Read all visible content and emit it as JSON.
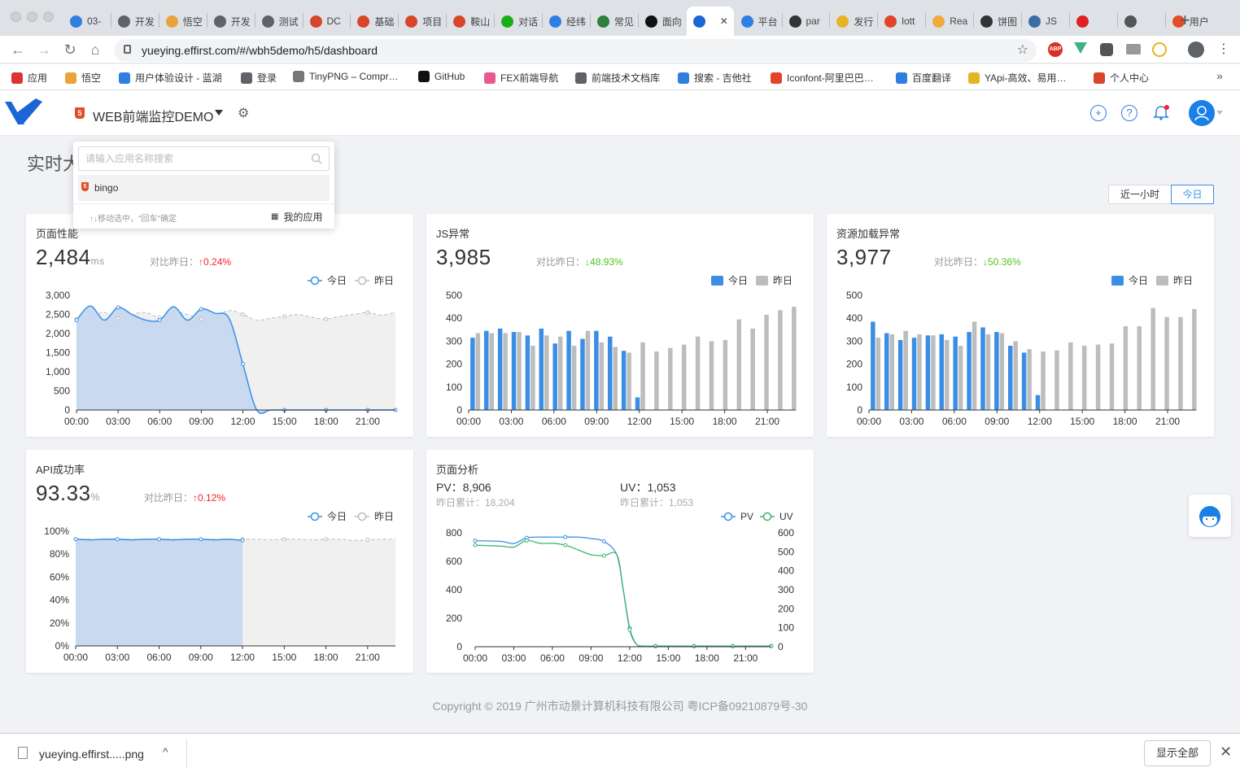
{
  "browser": {
    "tabs": [
      {
        "label": "03-",
        "color": "#2f7fe0"
      },
      {
        "label": "开发",
        "color": "#5f6368"
      },
      {
        "label": "悟空",
        "color": "#e8a33c"
      },
      {
        "label": "开发",
        "color": "#5f6368"
      },
      {
        "label": "测试",
        "color": "#5f6368"
      },
      {
        "label": "DC",
        "color": "#d9452b"
      },
      {
        "label": "基础",
        "color": "#d9452b"
      },
      {
        "label": "项目",
        "color": "#d9452b"
      },
      {
        "label": "鞍山",
        "color": "#d9452b"
      },
      {
        "label": "对话",
        "color": "#1aad19"
      },
      {
        "label": "经纬",
        "color": "#2f7fe0"
      },
      {
        "label": "常见",
        "color": "#2f7f3e"
      },
      {
        "label": "面向",
        "color": "#111111"
      },
      {
        "label": "",
        "color": "#1a66d6"
      },
      {
        "label": "平台",
        "color": "#2f7fe0"
      },
      {
        "label": "par",
        "color": "#333333"
      },
      {
        "label": "发行",
        "color": "#e6b422"
      },
      {
        "label": "lott",
        "color": "#e24329"
      },
      {
        "label": "Rea",
        "color": "#f0a93b"
      },
      {
        "label": "饼图",
        "color": "#333333"
      },
      {
        "label": "JS",
        "color": "#3c6ea5"
      },
      {
        "label": "",
        "color": "#e02020"
      },
      {
        "label": "",
        "color": "#555555"
      },
      {
        "label": "用户",
        "color": "#e44d26"
      }
    ],
    "url": "yueying.effirst.com/#/wbh5demo/h5/dashboard",
    "bookmarks": [
      {
        "label": "应用",
        "color": "#d33"
      },
      {
        "label": "悟空",
        "color": "#e8a33c"
      },
      {
        "label": "用户体验设计 - 蓝湖",
        "color": "#2f7fe0"
      },
      {
        "label": "登录",
        "color": "#5f6368"
      },
      {
        "label": "TinyPNG – Compr…",
        "color": "#777"
      },
      {
        "label": "GitHub",
        "color": "#111"
      },
      {
        "label": "FEX前端导航",
        "color": "#e8588f"
      },
      {
        "label": "前端技术文档库",
        "color": "#5f6368"
      },
      {
        "label": "搜索 - 吉他社",
        "color": "#2f7fe0"
      },
      {
        "label": "Iconfont-阿里巴巴…",
        "color": "#e24329"
      },
      {
        "label": "百度翻译",
        "color": "#2f7fe0"
      },
      {
        "label": "YApi-高效、易用…",
        "color": "#e6b422"
      },
      {
        "label": "个人中心",
        "color": "#d9452b"
      }
    ],
    "more_label": "»"
  },
  "app": {
    "name": "WEB前端监控DEMO",
    "page_title": "实时大",
    "ranges": [
      "近一小时",
      "今日"
    ],
    "dropdown": {
      "placeholder": "请输入应用名称搜索",
      "item": "bingo",
      "hint": "↑↓移动选中，\"回车\"确定",
      "my_apps": "我的应用"
    },
    "footer": "Copyright © 2019 广州市动景计算机科技有限公司 粤ICP备09210879号-30",
    "download_file": "yueying.effirst.....png",
    "show_all": "显示全部"
  },
  "cards": {
    "perf": {
      "title": "页面性能",
      "value": "2,484",
      "unit": "ms",
      "compare_label": "对比昨日：",
      "compare_value": "0.24%",
      "legend_today": "今日",
      "legend_yesterday": "昨日"
    },
    "js": {
      "title": "JS异常",
      "value": "3,985",
      "compare_label": "对比昨日：",
      "compare_value": "48.93%",
      "legend_today": "今日",
      "legend_yesterday": "昨日"
    },
    "res": {
      "title": "资源加载异常",
      "value": "3,977",
      "compare_label": "对比昨日：",
      "compare_value": "50.36%",
      "legend_today": "今日",
      "legend_yesterday": "昨日"
    },
    "api": {
      "title": "API成功率",
      "value": "93.33",
      "unit": "%",
      "compare_label": "对比昨日：",
      "compare_value": "0.12%",
      "legend_today": "今日",
      "legend_yesterday": "昨日"
    },
    "page": {
      "title": "页面分析",
      "pv_label": "PV：",
      "pv_value": "8,906",
      "uv_label": "UV：",
      "uv_value": "1,053",
      "pv_prev": "昨日累计：18,204",
      "uv_prev": "昨日累计：1,053",
      "legend_pv": "PV",
      "legend_uv": "UV"
    }
  },
  "colors": {
    "today": "#3a8ee6",
    "yesterday": "#bdbdbd",
    "uv": "#3cb371",
    "up": "#f5222d",
    "down": "#52c41a"
  },
  "chart_data": [
    {
      "id": "perf",
      "type": "area",
      "x_ticks": [
        "00:00",
        "03:00",
        "06:00",
        "09:00",
        "12:00",
        "15:00",
        "18:00",
        "21:00"
      ],
      "y_ticks": [
        "0",
        "500",
        "1,000",
        "1,500",
        "2,000",
        "2,500",
        "3,000"
      ],
      "ylim": [
        0,
        3000
      ],
      "xlim": [
        0,
        23
      ],
      "series": [
        {
          "name": "今日",
          "x": [
            0,
            1,
            2,
            3,
            4,
            5,
            6,
            7,
            8,
            9,
            10,
            11,
            12,
            13,
            14,
            15,
            16,
            17,
            18,
            19,
            20,
            21,
            22,
            23
          ],
          "values": [
            2350,
            2720,
            2350,
            2680,
            2500,
            2350,
            2350,
            2700,
            2350,
            2640,
            2530,
            2400,
            1200,
            0,
            0,
            0,
            0,
            0,
            0,
            0,
            0,
            0,
            0,
            0
          ]
        },
        {
          "name": "昨日",
          "x": [
            0,
            1,
            2,
            3,
            4,
            5,
            6,
            7,
            8,
            9,
            10,
            11,
            12,
            13,
            14,
            15,
            16,
            17,
            18,
            19,
            20,
            21,
            22,
            23
          ],
          "values": [
            2380,
            2450,
            2550,
            2400,
            2500,
            2550,
            2420,
            2560,
            2500,
            2380,
            2450,
            2600,
            2500,
            2350,
            2400,
            2450,
            2500,
            2420,
            2380,
            2450,
            2500,
            2550,
            2480,
            2560
          ]
        }
      ]
    },
    {
      "id": "js",
      "type": "bar",
      "x_ticks": [
        "00:00",
        "03:00",
        "06:00",
        "09:00",
        "12:00",
        "15:00",
        "18:00",
        "21:00"
      ],
      "y_ticks": [
        "0",
        "100",
        "200",
        "300",
        "400",
        "500"
      ],
      "ylim": [
        0,
        500
      ],
      "series": [
        {
          "name": "今日",
          "values": [
            315,
            345,
            355,
            340,
            325,
            355,
            290,
            345,
            310,
            345,
            320,
            258,
            55,
            0,
            0,
            0,
            0,
            0,
            0,
            0,
            0,
            0,
            0,
            0
          ]
        },
        {
          "name": "昨日",
          "values": [
            335,
            335,
            335,
            340,
            280,
            325,
            320,
            280,
            345,
            295,
            275,
            250,
            295,
            255,
            270,
            285,
            320,
            300,
            305,
            395,
            355,
            415,
            435,
            450
          ]
        }
      ]
    },
    {
      "id": "res",
      "type": "bar",
      "x_ticks": [
        "00:00",
        "03:00",
        "06:00",
        "09:00",
        "12:00",
        "15:00",
        "18:00",
        "21:00"
      ],
      "y_ticks": [
        "0",
        "100",
        "200",
        "300",
        "400",
        "500"
      ],
      "ylim": [
        0,
        500
      ],
      "series": [
        {
          "name": "今日",
          "values": [
            385,
            335,
            305,
            315,
            325,
            330,
            320,
            340,
            360,
            340,
            280,
            250,
            65,
            0,
            0,
            0,
            0,
            0,
            0,
            0,
            0,
            0,
            0,
            0
          ]
        },
        {
          "name": "昨日",
          "values": [
            315,
            330,
            345,
            330,
            325,
            305,
            280,
            385,
            330,
            335,
            300,
            265,
            255,
            260,
            295,
            280,
            285,
            290,
            365,
            365,
            445,
            405,
            405,
            440
          ]
        }
      ]
    },
    {
      "id": "api",
      "type": "area",
      "x_ticks": [
        "00:00",
        "03:00",
        "06:00",
        "09:00",
        "12:00",
        "15:00",
        "18:00",
        "21:00"
      ],
      "y_ticks": [
        "0%",
        "20%",
        "40%",
        "60%",
        "80%",
        "100%"
      ],
      "ylim": [
        0,
        100
      ],
      "xlim": [
        0,
        23
      ],
      "series": [
        {
          "name": "今日",
          "x": [
            0,
            1,
            2,
            3,
            4,
            5,
            6,
            7,
            8,
            9,
            10,
            11,
            12
          ],
          "values": [
            93,
            92.5,
            93,
            93,
            92.5,
            93,
            93,
            92.5,
            93,
            93,
            92.5,
            93,
            92
          ]
        },
        {
          "name": "昨日",
          "x": [
            0,
            1,
            2,
            3,
            4,
            5,
            6,
            7,
            8,
            9,
            10,
            11,
            12,
            13,
            14,
            15,
            16,
            17,
            18,
            19,
            20,
            21,
            22,
            23
          ],
          "values": [
            93,
            93,
            92,
            93,
            93,
            92.5,
            93,
            93,
            92.5,
            93,
            93,
            92,
            93,
            93,
            92.5,
            93,
            93,
            92.5,
            93,
            93,
            92,
            92.5,
            93,
            93
          ]
        }
      ]
    },
    {
      "id": "page",
      "type": "line",
      "x_ticks": [
        "00:00",
        "03:00",
        "06:00",
        "09:00",
        "12:00",
        "15:00",
        "18:00",
        "21:00"
      ],
      "y_ticks_left": [
        "0",
        "200",
        "400",
        "600",
        "800"
      ],
      "y_ticks_right": [
        "0",
        "100",
        "200",
        "300",
        "400",
        "500",
        "600"
      ],
      "ylim_left": [
        0,
        800
      ],
      "ylim_right": [
        0,
        600
      ],
      "series": [
        {
          "name": "PV",
          "axis": "left",
          "x": [
            0,
            2,
            3,
            4,
            5,
            6,
            7,
            8,
            9,
            10,
            11,
            11.5,
            12,
            12.5,
            13,
            14,
            15,
            16,
            17,
            18,
            19,
            20,
            21,
            22,
            23
          ],
          "values": [
            745,
            740,
            725,
            765,
            770,
            770,
            770,
            770,
            760,
            740,
            645,
            400,
            130,
            20,
            5,
            5,
            5,
            5,
            5,
            5,
            5,
            5,
            5,
            5,
            5
          ]
        },
        {
          "name": "UV",
          "axis": "right",
          "x": [
            0,
            2,
            3,
            4,
            5,
            6,
            7,
            8,
            9,
            10,
            11,
            11.5,
            12,
            12.5,
            13,
            14,
            15,
            16,
            17,
            18,
            19,
            20,
            21,
            22,
            23
          ],
          "values": [
            535,
            530,
            525,
            560,
            545,
            545,
            535,
            510,
            485,
            480,
            485,
            300,
            90,
            15,
            3,
            2,
            2,
            2,
            2,
            2,
            2,
            2,
            2,
            2,
            2
          ]
        }
      ]
    }
  ]
}
